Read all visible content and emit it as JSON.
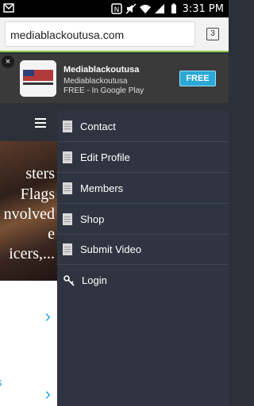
{
  "status_bar": {
    "time": "3:31 PM",
    "icons": [
      "notification-icon",
      "nfc-icon",
      "mute-icon",
      "wifi-icon",
      "signal-icon",
      "battery-icon"
    ]
  },
  "browser": {
    "url": "mediablackoutusa.com",
    "tab_count": "3"
  },
  "app_banner": {
    "close_label": "×",
    "title": "Mediablackoutusa",
    "subtitle": "Mediablackoutusa",
    "store_line": "FREE - In Google Play",
    "install_label": "FREE",
    "accent_color": "#2aa8d8"
  },
  "background_page": {
    "hero_lines": [
      "sters",
      "Flags",
      "nvolved",
      "e",
      "icers,..."
    ],
    "card_link_text": "rs"
  },
  "menu": {
    "items": [
      {
        "label": "Contact",
        "icon": "document-icon"
      },
      {
        "label": "Edit Profile",
        "icon": "document-icon"
      },
      {
        "label": "Members",
        "icon": "document-icon"
      },
      {
        "label": "Shop",
        "icon": "document-icon"
      },
      {
        "label": "Submit Video",
        "icon": "document-icon"
      },
      {
        "label": "Login",
        "icon": "key-icon"
      }
    ]
  }
}
